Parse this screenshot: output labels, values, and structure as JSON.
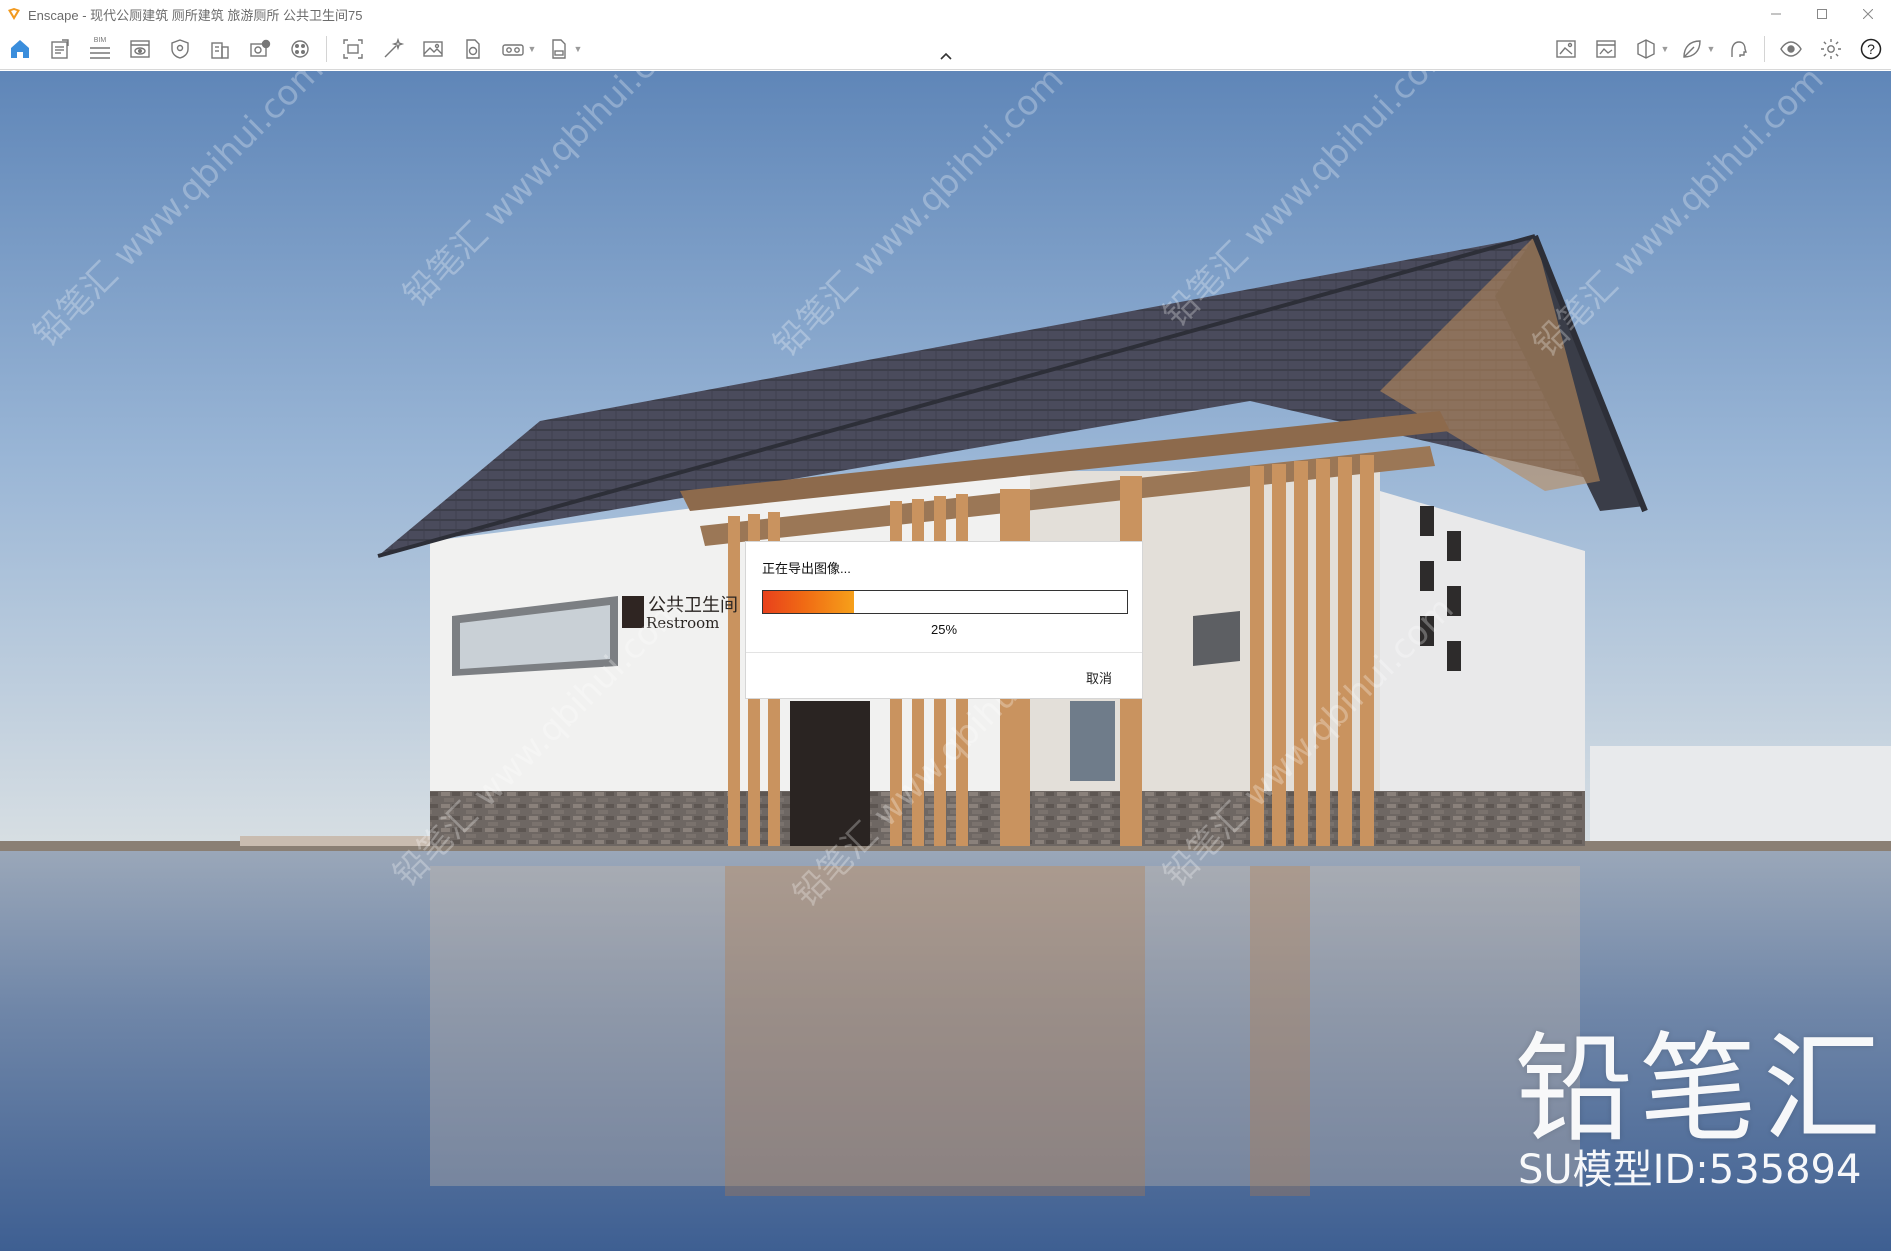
{
  "window": {
    "title": "Enscape - 现代公厕建筑 厕所建筑 旅游厕所 公共卫生间75",
    "controls": [
      "minimize-icon",
      "maximize-icon",
      "close-icon"
    ]
  },
  "toolbar": {
    "left_icons": [
      "home-icon",
      "document-icon",
      "bim-list-icon",
      "view-icon",
      "shield-icon",
      "building-icon",
      "camera-add-icon",
      "palette-icon",
      "screenshot-icon",
      "magic-wand-icon",
      "image-icon",
      "file-refresh-icon",
      "vr-headset-icon",
      "export-file-icon"
    ],
    "right_icons": [
      "image-crop-icon",
      "gallery-icon",
      "cube-icon",
      "leaf-icon",
      "head-icon",
      "eye-icon",
      "settings-icon",
      "help-icon"
    ],
    "bim_label": "BIM",
    "help_label": "?"
  },
  "dialog": {
    "message": "正在导出图像...",
    "progress": 0.25,
    "percent_label": "25%",
    "cancel_label": "取消"
  },
  "scene": {
    "sign_cn": "公共卫生间",
    "sign_en": "Restroom"
  },
  "watermark": {
    "brand": "铅笔汇",
    "model_id": "SU模型ID:535894",
    "repeat_cn": "铅笔汇",
    "repeat_url": "www.qbihui.com"
  },
  "colors": {
    "accent_blue": "#3b8edc",
    "progress_start": "#e8411c",
    "progress_end": "#f6a01a",
    "logo_orange": "#f29a1f"
  }
}
